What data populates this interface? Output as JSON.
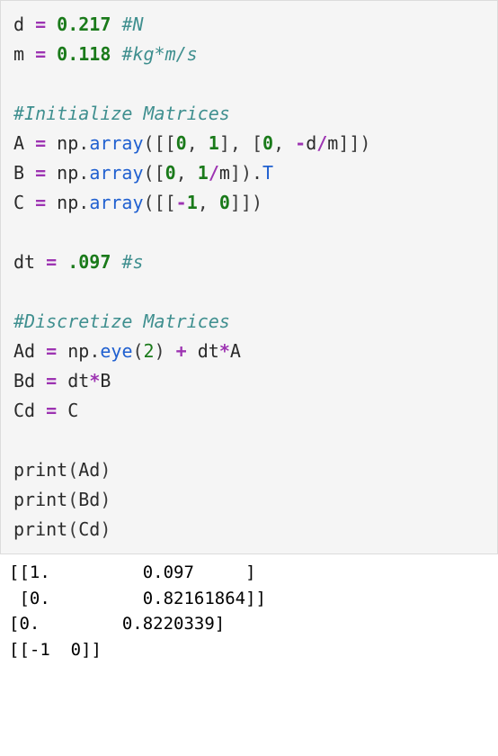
{
  "cell": {
    "line1": {
      "var": "d",
      "assign": " = ",
      "val": "0.217",
      "sp": " ",
      "comment": "#N"
    },
    "line2": {
      "var": "m",
      "assign": " = ",
      "val": "0.118",
      "sp": " ",
      "comment": "#kg*m/s"
    },
    "blank1": "",
    "line4": {
      "comment": "#Initialize Matrices"
    },
    "line5": {
      "var": "A",
      "assign": " = ",
      "np": "np",
      "dot": ".",
      "fn": "array",
      "open": "([[",
      "z1": "0",
      "c1": ", ",
      "one1": "1",
      "mid": "], [",
      "z2": "0",
      "c2": ", ",
      "neg": "-",
      "dvar": "d",
      "slash": "/",
      "mvar": "m",
      "close": "]])"
    },
    "line6": {
      "var": "B",
      "assign": " = ",
      "np": "np",
      "dot": ".",
      "fn": "array",
      "open": "([",
      "z1": "0",
      "c1": ", ",
      "one1": "1",
      "slash": "/",
      "mvar": "m",
      "close": "]).",
      "attr": "T"
    },
    "line7": {
      "var": "C",
      "assign": " = ",
      "np": "np",
      "dot": ".",
      "fn": "array",
      "open": "([[",
      "neg": "-",
      "one1": "1",
      "c1": ", ",
      "z1": "0",
      "close": "]])"
    },
    "blank2": "",
    "line9": {
      "var": "dt",
      "assign": " = ",
      "val": ".097",
      "sp": " ",
      "comment": "#s"
    },
    "blank3": "",
    "line11": {
      "comment": "#Discretize Matrices"
    },
    "line12": {
      "var": "Ad",
      "assign": " = ",
      "np": "np",
      "dot": ".",
      "fn": "eye",
      "open": "(",
      "arg": "2",
      "close": ")",
      "sp": " ",
      "plus": "+",
      "sp2": " ",
      "dt": "dt",
      "star": "*",
      "avar": "A"
    },
    "line13": {
      "var": "Bd",
      "assign": " = ",
      "dt": "dt",
      "star": "*",
      "bvar": "B"
    },
    "line14": {
      "var": "Cd",
      "assign": " = ",
      "cvar": "C"
    },
    "blank4": "",
    "line16": {
      "fn": "print",
      "open": "(",
      "arg": "Ad",
      "close": ")"
    },
    "line17": {
      "fn": "print",
      "open": "(",
      "arg": "Bd",
      "close": ")"
    },
    "line18": {
      "fn": "print",
      "open": "(",
      "arg": "Cd",
      "close": ")"
    }
  },
  "output": {
    "line1": "[[1.         0.097     ]",
    "line2": " [0.         0.82161864]]",
    "line3": "[0.        0.8220339]",
    "line4": "[[-1  0]]"
  }
}
